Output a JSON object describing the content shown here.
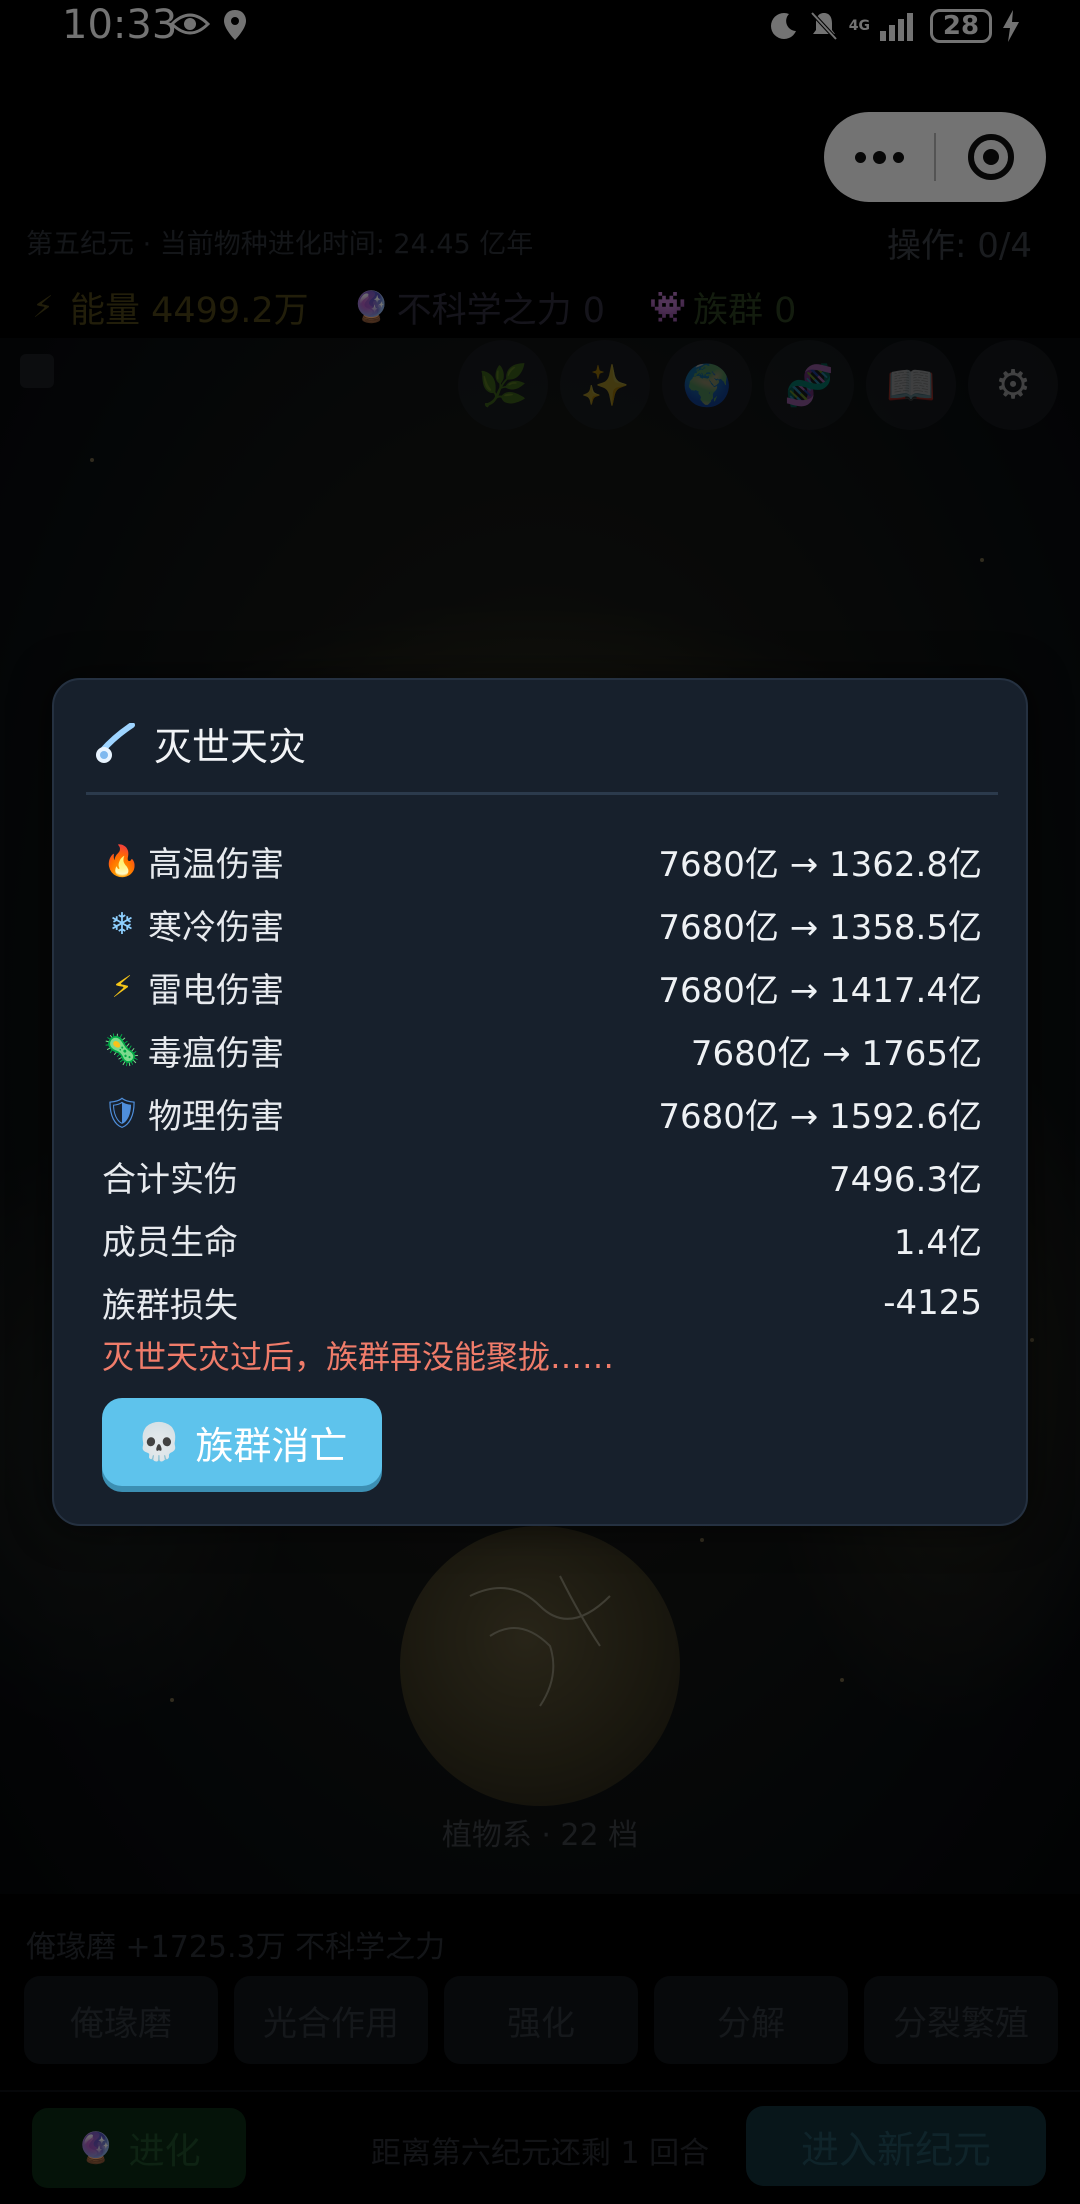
{
  "status_bar": {
    "time": "10:33",
    "battery": "28",
    "network": "4G"
  },
  "capsule": {
    "more_icon": "more-dots-icon",
    "close_icon": "target-close-icon"
  },
  "header": {
    "era_info": "第五纪元 · 当前物种进化时间: 24.45 亿年",
    "operations": "操作: 0/4",
    "resources": [
      {
        "icon": "⚡",
        "label": "能量 4499.2万"
      },
      {
        "icon": "🔮",
        "label": "不科学之力 0"
      },
      {
        "icon": "👾",
        "label": "族群 0"
      }
    ]
  },
  "toolbar": {
    "tools": [
      {
        "icon": "🌿",
        "name": "plant-tool"
      },
      {
        "icon": "✨",
        "name": "sparkle-tool"
      },
      {
        "icon": "🌍",
        "name": "globe-tool"
      },
      {
        "icon": "🧬",
        "name": "dna-tool"
      },
      {
        "icon": "📖",
        "name": "book-tool"
      },
      {
        "icon": "⚙",
        "name": "settings-tool"
      }
    ]
  },
  "game": {
    "species_label": "植物系 · 22 档"
  },
  "modal": {
    "title": "灭世天灾",
    "rows": [
      {
        "icon": "🔥",
        "label": "高温伤害",
        "value": "7680亿 → 1362.8亿"
      },
      {
        "icon": "❄",
        "label": "寒冷伤害",
        "value": "7680亿 → 1358.5亿"
      },
      {
        "icon": "⚡",
        "label": "雷电伤害",
        "value": "7680亿 → 1417.4亿"
      },
      {
        "icon": "🦠",
        "label": "毒瘟伤害",
        "value": "7680亿 → 1765亿"
      },
      {
        "icon": "🛡",
        "label": "物理伤害",
        "value": "7680亿 → 1592.6亿"
      },
      {
        "icon": "",
        "label": "合计实伤",
        "value": "7496.3亿"
      },
      {
        "icon": "",
        "label": "成员生命",
        "value": "1.4亿"
      },
      {
        "icon": "",
        "label": "族群损失",
        "value": "-4125"
      }
    ],
    "warning": "灭世天灾过后，族群再没能聚拢……",
    "button": {
      "icon": "💀",
      "label": "族群消亡"
    },
    "colors": {
      "warning": "#f07c6a",
      "button": "#5ec3ec"
    }
  },
  "bottom": {
    "harvest_text": "俺瑑磨 +1725.3万 不科学之力",
    "actions": [
      "俺瑑磨",
      "光合作用",
      "强化",
      "分解",
      "分裂繁殖"
    ],
    "evolve": {
      "icon": "🔮",
      "label": "进化"
    },
    "countdown": "距离第六纪元还剩 1 回合",
    "new_era": "进入新纪元"
  }
}
